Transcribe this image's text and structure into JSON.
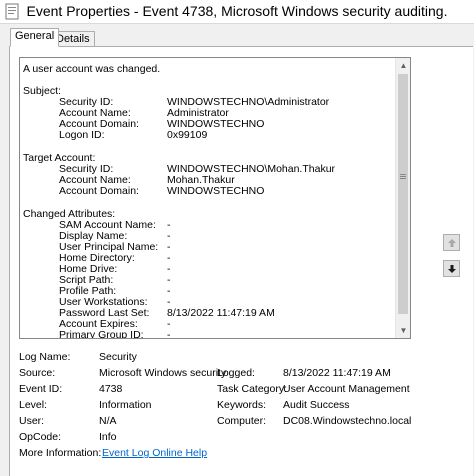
{
  "window": {
    "title": "Event Properties - Event 4738, Microsoft Windows security auditing."
  },
  "tabs": [
    {
      "label": "General"
    },
    {
      "label": "Details"
    }
  ],
  "description": {
    "header": "A user account was changed.",
    "subject_label": "Subject:",
    "subject": [
      {
        "key": "Security ID:",
        "value": "WINDOWSTECHNO\\Administrator"
      },
      {
        "key": "Account Name:",
        "value": "Administrator"
      },
      {
        "key": "Account Domain:",
        "value": "WINDOWSTECHNO"
      },
      {
        "key": "Logon ID:",
        "value": "0x99109"
      }
    ],
    "target_label": "Target Account:",
    "target": [
      {
        "key": "Security ID:",
        "value": "WINDOWSTECHNO\\Mohan.Thakur"
      },
      {
        "key": "Account Name:",
        "value": "Mohan.Thakur"
      },
      {
        "key": "Account Domain:",
        "value": "WINDOWSTECHNO"
      }
    ],
    "changed_label": "Changed Attributes:",
    "changed": [
      {
        "key": "SAM Account Name:",
        "value": "-"
      },
      {
        "key": "Display Name:",
        "value": "-"
      },
      {
        "key": "User Principal Name:",
        "value": "-"
      },
      {
        "key": "Home Directory:",
        "value": "-"
      },
      {
        "key": "Home Drive:",
        "value": "-"
      },
      {
        "key": "Script Path:",
        "value": "-"
      },
      {
        "key": "Profile Path:",
        "value": "-"
      },
      {
        "key": "User Workstations:",
        "value": "-"
      },
      {
        "key": "Password Last Set:",
        "value": "8/13/2022 11:47:19 AM"
      },
      {
        "key": "Account Expires:",
        "value": "-"
      },
      {
        "key": "Primary Group ID:",
        "value": "-"
      }
    ]
  },
  "info": {
    "log_name_label": "Log Name:",
    "log_name": "Security",
    "source_label": "Source:",
    "source": "Microsoft Windows security",
    "logged_label": "Logged:",
    "logged": "8/13/2022 11:47:19 AM",
    "event_id_label": "Event ID:",
    "event_id": "4738",
    "task_category_label": "Task Category:",
    "task_category": "User Account Management",
    "level_label": "Level:",
    "level": "Information",
    "keywords_label": "Keywords:",
    "keywords": "Audit Success",
    "user_label": "User:",
    "user": "N/A",
    "computer_label": "Computer:",
    "computer": "DC08.Windowstechno.local",
    "opcode_label": "OpCode:",
    "opcode": "Info",
    "more_info_label": "More Information:",
    "more_info_link": "Event Log Online Help"
  },
  "icons": {
    "title_icon": "event-properties-icon",
    "scroll_up": "scroll-up-arrow-icon",
    "scroll_down": "scroll-down-arrow-icon",
    "prev_event": "up-arrow-icon",
    "next_event": "down-arrow-icon"
  },
  "colors": {
    "link": "#0066cc",
    "window_bg": "#f0f0f0"
  }
}
